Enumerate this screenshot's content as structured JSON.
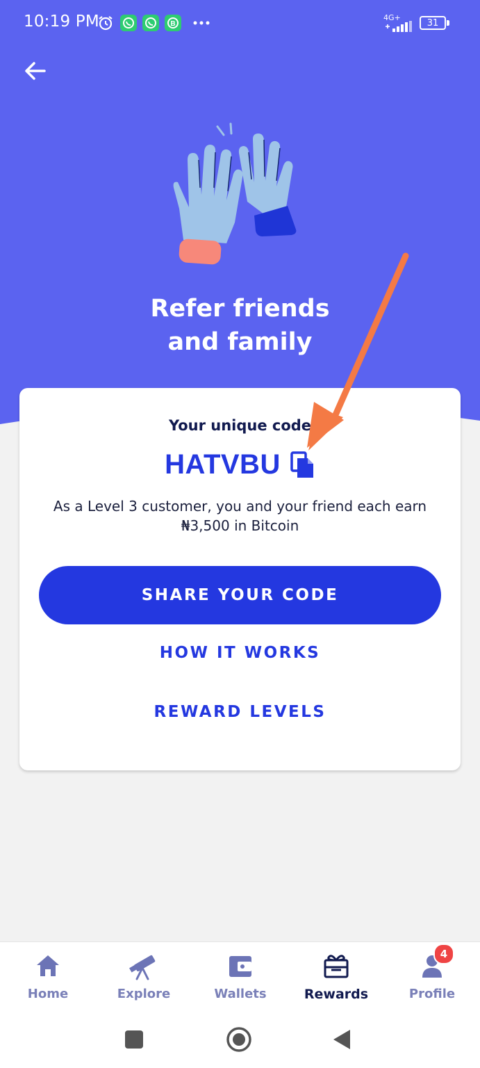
{
  "status_bar": {
    "time": "10:19 PM",
    "icons": [
      "alarm-icon",
      "whatsapp-icon",
      "whatsapp-icon",
      "whatsapp-business-icon",
      "more-dots-icon"
    ],
    "network": "4G+",
    "battery": "31"
  },
  "header": {
    "back_icon": "arrow-left-icon",
    "title_line1": "Refer friends",
    "title_line2": "and family"
  },
  "card": {
    "code_label": "Your unique code",
    "code_value": "HATVBU",
    "copy_icon": "copy-icon",
    "description": "As a Level 3 customer, you and your friend each earn ₦3,500 in Bitcoin",
    "share_button": "SHARE YOUR CODE",
    "how_it_works": "HOW IT WORKS",
    "reward_levels": "REWARD LEVELS"
  },
  "bottom_nav": {
    "items": [
      {
        "label": "Home",
        "icon": "home-icon",
        "active": false
      },
      {
        "label": "Explore",
        "icon": "telescope-icon",
        "active": false
      },
      {
        "label": "Wallets",
        "icon": "wallet-icon",
        "active": false
      },
      {
        "label": "Rewards",
        "icon": "gift-icon",
        "active": true
      },
      {
        "label": "Profile",
        "icon": "user-icon",
        "active": false,
        "badge": "4"
      }
    ]
  },
  "colors": {
    "hero_bg": "#5b63f0",
    "primary": "#2438e0",
    "dark_text": "#111a4f",
    "nav_inactive": "#7a80b8",
    "badge": "#ef4444",
    "annotation_arrow": "#f47a45"
  }
}
